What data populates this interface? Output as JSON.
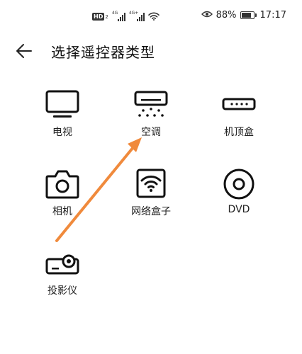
{
  "status_bar": {
    "network_badge": "HD",
    "network_badge_sub": "2",
    "sim1_generation": "4G",
    "sim2_generation": "4G+",
    "battery_percent": "88%",
    "battery_level": 0.88,
    "time": "17:17"
  },
  "header": {
    "title": "选择遥控器类型"
  },
  "devices": [
    {
      "label": "电视",
      "icon": "tv-icon"
    },
    {
      "label": "空调",
      "icon": "air-conditioner-icon"
    },
    {
      "label": "机顶盒",
      "icon": "set-top-box-icon"
    },
    {
      "label": "相机",
      "icon": "camera-icon"
    },
    {
      "label": "网络盒子",
      "icon": "network-box-icon"
    },
    {
      "label": "DVD",
      "icon": "dvd-icon"
    },
    {
      "label": "投影仪",
      "icon": "projector-icon"
    }
  ],
  "annotation": {
    "arrow_color": "#f08a3c"
  }
}
